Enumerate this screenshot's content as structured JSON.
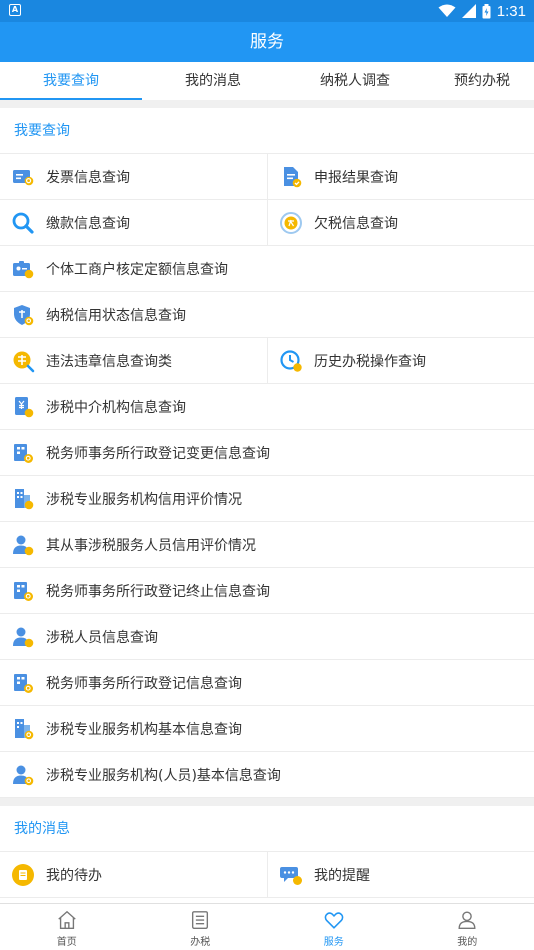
{
  "status_bar": {
    "time": "1:31",
    "notification_icon": "a-letter-icon",
    "icons": [
      "wifi-icon",
      "signal-icon",
      "battery-icon"
    ]
  },
  "app_bar": {
    "title": "服务"
  },
  "tabs": [
    {
      "label": "我要查询",
      "active": true
    },
    {
      "label": "我的消息",
      "active": false
    },
    {
      "label": "纳税人调查",
      "active": false
    },
    {
      "label": "预约办税",
      "active": false
    }
  ],
  "query_section": {
    "title": "我要查询",
    "rows": [
      [
        {
          "label": "发票信息查询",
          "icon": "invoice-icon"
        },
        {
          "label": "申报结果查询",
          "icon": "declare-result-icon"
        }
      ],
      [
        {
          "label": "缴款信息查询",
          "icon": "search-icon"
        },
        {
          "label": "欠税信息查询",
          "icon": "owed-tax-icon"
        }
      ],
      [
        {
          "label": "个体工商户核定定额信息查询",
          "icon": "business-id-icon"
        }
      ],
      [
        {
          "label": "纳税信用状态信息查询",
          "icon": "credit-shield-icon"
        }
      ],
      [
        {
          "label": "违法违章信息查询类",
          "icon": "violation-icon"
        },
        {
          "label": "历史办税操作查询",
          "icon": "history-clock-icon"
        }
      ],
      [
        {
          "label": "涉税中介机构信息查询",
          "icon": "agency-doc-icon"
        }
      ],
      [
        {
          "label": "税务师事务所行政登记变更信息查询",
          "icon": "office-search-icon"
        }
      ],
      [
        {
          "label": "涉税专业服务机构信用评价情况",
          "icon": "building-icon"
        }
      ],
      [
        {
          "label": "其从事涉税服务人员信用评价情况",
          "icon": "person-badge-icon"
        }
      ],
      [
        {
          "label": "税务师事务所行政登记终止信息查询",
          "icon": "office-search-icon"
        }
      ],
      [
        {
          "label": "涉税人员信息查询",
          "icon": "person-badge-icon"
        }
      ],
      [
        {
          "label": "税务师事务所行政登记信息查询",
          "icon": "office-search-icon"
        }
      ],
      [
        {
          "label": "涉税专业服务机构基本信息查询",
          "icon": "building-search-icon"
        }
      ],
      [
        {
          "label": "涉税专业服务机构(人员)基本信息查询",
          "icon": "person-search-icon"
        }
      ]
    ]
  },
  "message_section": {
    "title": "我的消息",
    "rows": [
      [
        {
          "label": "我的待办",
          "icon": "todo-icon"
        },
        {
          "label": "我的提醒",
          "icon": "reminder-chat-icon"
        }
      ]
    ]
  },
  "bottom_nav": [
    {
      "label": "首页",
      "icon": "home-icon",
      "active": false
    },
    {
      "label": "办税",
      "icon": "list-icon",
      "active": false
    },
    {
      "label": "服务",
      "icon": "heart-icon",
      "active": true
    },
    {
      "label": "我的",
      "icon": "user-icon",
      "active": false
    }
  ],
  "colors": {
    "primary": "#2196f3",
    "status_bar": "#1a87e0",
    "accent_yellow": "#f5b800",
    "divider": "#ececec"
  }
}
